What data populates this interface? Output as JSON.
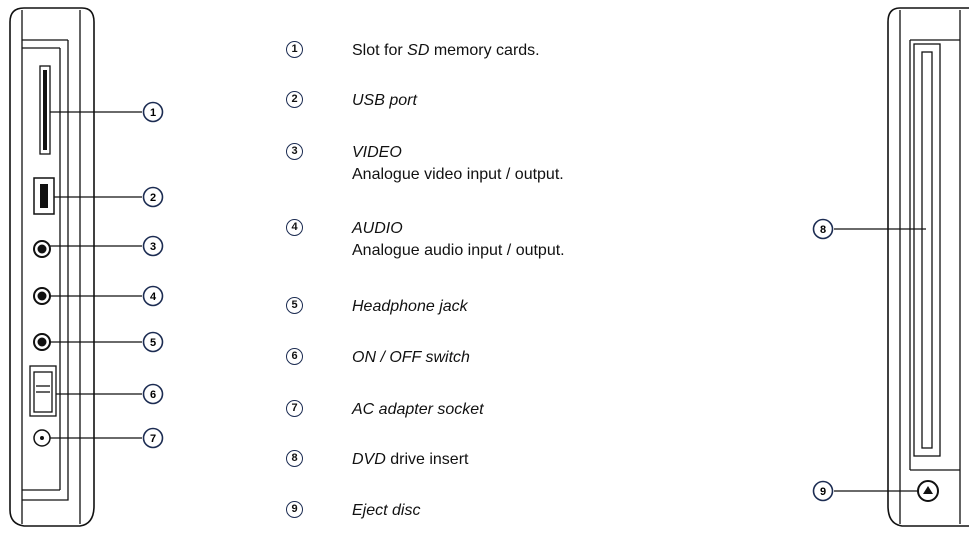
{
  "callout_numbers": [
    "1",
    "2",
    "3",
    "4",
    "5",
    "6",
    "7",
    "8",
    "9"
  ],
  "legend": [
    {
      "num": "1",
      "prefix": "Slot for ",
      "italic": "SD",
      "suffix": " memory cards.",
      "desc": ""
    },
    {
      "num": "2",
      "prefix": "",
      "italic": "USB port",
      "suffix": "",
      "desc": ""
    },
    {
      "num": "3",
      "prefix": "",
      "italic": "VIDEO",
      "suffix": "",
      "desc": "Analogue video input / output."
    },
    {
      "num": "4",
      "prefix": "",
      "italic": "AUDIO",
      "suffix": "",
      "desc": "Analogue audio input / output."
    },
    {
      "num": "5",
      "prefix": "",
      "italic": "Headphone jack",
      "suffix": "",
      "desc": ""
    },
    {
      "num": "6",
      "prefix": "",
      "italic": "ON / OFF switch",
      "suffix": "",
      "desc": ""
    },
    {
      "num": "7",
      "prefix": "",
      "italic": "AC adapter socket",
      "suffix": "",
      "desc": ""
    },
    {
      "num": "8",
      "prefix": "",
      "italic": "DVD",
      "suffix": " drive insert",
      "desc": ""
    },
    {
      "num": "9",
      "prefix": "",
      "italic": "Eject disc",
      "suffix": "",
      "desc": ""
    }
  ],
  "colors": {
    "badge_border": "#1c2c52",
    "line": "#111111",
    "body_fill": "#ffffff"
  }
}
